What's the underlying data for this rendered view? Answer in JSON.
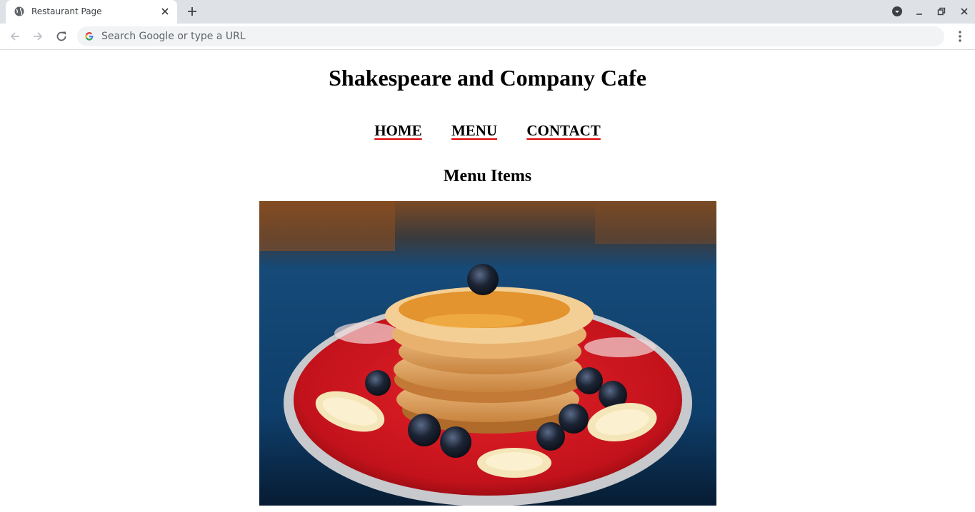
{
  "browser": {
    "tab_title": "Restaurant Page",
    "omnibox_placeholder": "Search Google or type a URL"
  },
  "page": {
    "site_title": "Shakespeare and Company Cafe",
    "nav": [
      "HOME",
      "MENU",
      "CONTACT"
    ],
    "section_title": "Menu Items"
  },
  "colors": {
    "tabstrip": "#dee1e6",
    "nav_underline": "#e00000"
  }
}
